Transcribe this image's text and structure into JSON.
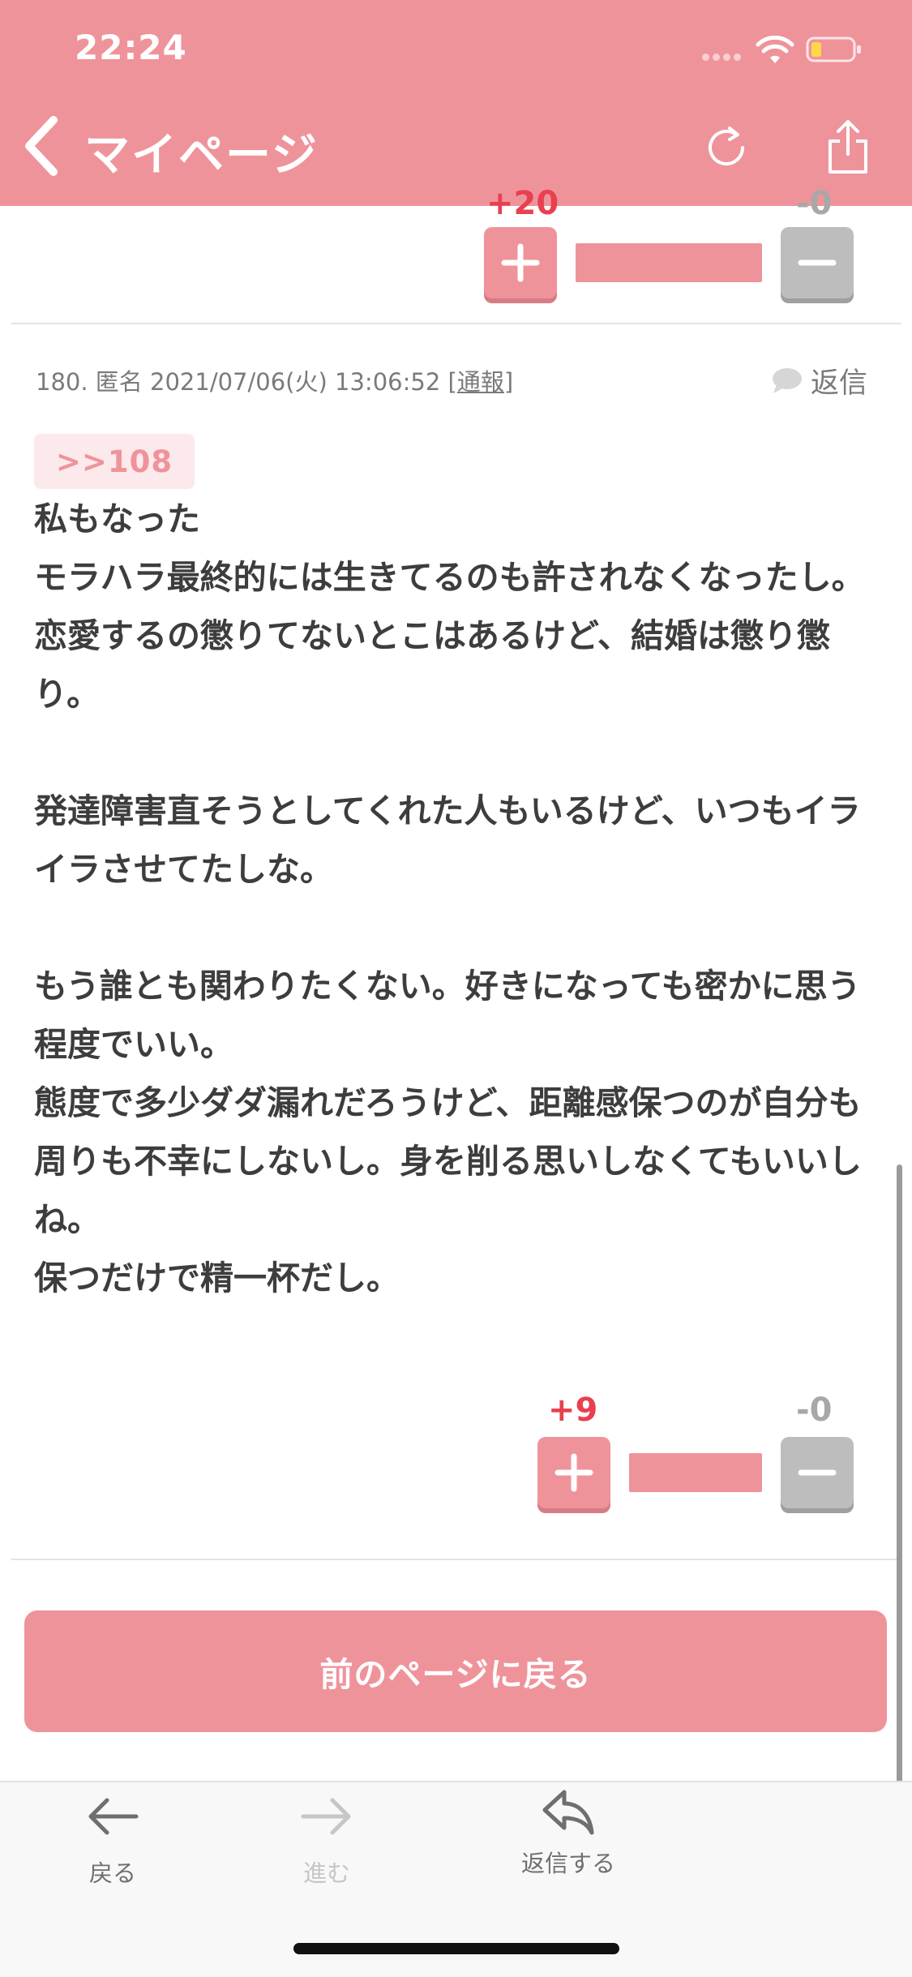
{
  "status_bar": {
    "time": "22:24"
  },
  "nav": {
    "title": "マイページ",
    "icons": [
      "chevron-left-icon",
      "refresh-icon",
      "share-icon"
    ]
  },
  "prev_post_votes": {
    "plus_count": "+20",
    "minus_count": "-0",
    "bar_fill_percent": 100
  },
  "post": {
    "number": "180.",
    "author": "匿名",
    "datetime": "2021/07/06(火) 13:06:52",
    "report_open": "[",
    "report_label": "通報",
    "report_close": "]",
    "reply_label": "返信",
    "anchor": ">>108",
    "body": "私もなった\nモラハラ最終的には生きてるのも許されなくなったし。\n恋愛するの懲りてないとこはあるけど、結婚は懲り懲り。\n\n発達障害直そうとしてくれた人もいるけど、いつもイライラさせてたしな。\n\nもう誰とも関わりたくない。好きになっても密かに思う程度でいい。\n態度で多少ダダ漏れだろうけど、距離感保つのが自分も周りも不幸にしないし。身を削る思いしなくてもいいしね。\n保つだけで精一杯だし。",
    "votes": {
      "plus_count": "+9",
      "minus_count": "-0",
      "bar_fill_percent": 100
    }
  },
  "buttons": {
    "back_page": "前のページに戻る"
  },
  "toolbar": {
    "back": "戻る",
    "forward": "進む",
    "reply": "返信する"
  },
  "colors": {
    "brand_pink": "#ef939b",
    "plus_red": "#e8404f",
    "minus_gray": "#bdbdbd"
  }
}
